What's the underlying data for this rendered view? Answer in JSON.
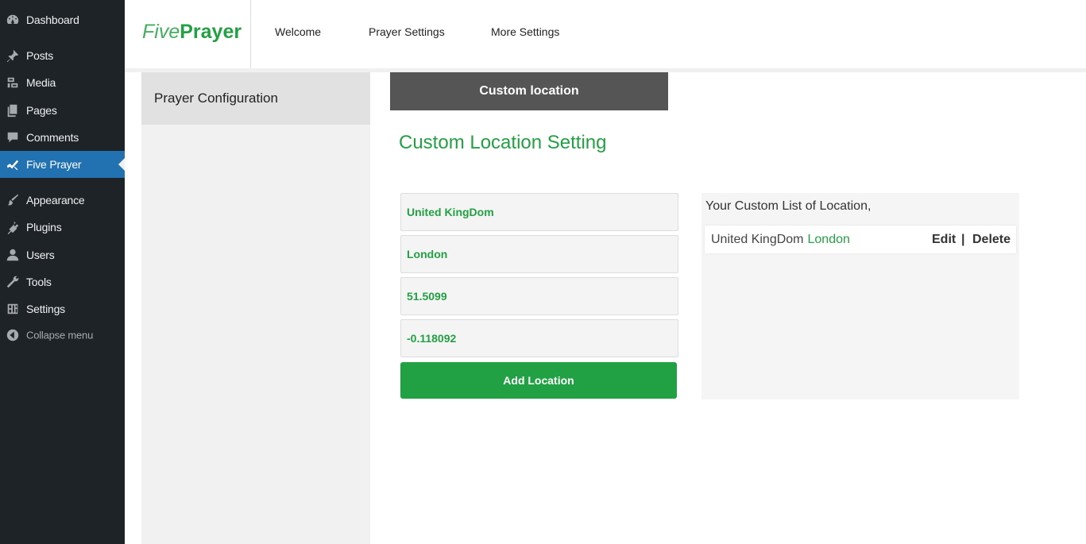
{
  "sidebar": {
    "items": [
      {
        "label": "Dashboard",
        "icon": "dashboard-icon"
      },
      {
        "label": "Posts",
        "icon": "pin-icon"
      },
      {
        "label": "Media",
        "icon": "media-icon"
      },
      {
        "label": "Pages",
        "icon": "pages-icon"
      },
      {
        "label": "Comments",
        "icon": "comment-icon"
      },
      {
        "label": "Five Prayer",
        "icon": "five-prayer-icon",
        "current": true
      },
      {
        "label": "Appearance",
        "icon": "brush-icon"
      },
      {
        "label": "Plugins",
        "icon": "plugin-icon"
      },
      {
        "label": "Users",
        "icon": "user-icon"
      },
      {
        "label": "Tools",
        "icon": "wrench-icon"
      },
      {
        "label": "Settings",
        "icon": "settings-icon"
      }
    ],
    "collapse_label": "Collapse menu",
    "colors": {
      "background": "#1d2327",
      "current": "#2271b1"
    }
  },
  "header": {
    "logo_light": "Five",
    "logo_bold": "Prayer",
    "nav": [
      "Welcome",
      "Prayer Settings",
      "More Settings"
    ]
  },
  "config": {
    "tab_label": "Prayer Configuration"
  },
  "custom": {
    "tab_label": "Custom location",
    "section_title": "Custom Location Setting",
    "fields": {
      "country": "United KingDom",
      "city": "London",
      "latitude": "51.5099",
      "longitude": "-0.118092"
    },
    "add_button": "Add Location",
    "accent_color": "#23a043"
  },
  "list": {
    "heading": "Your Custom List of Location,",
    "rows": [
      {
        "country": "United KingDom",
        "city": "London",
        "edit": "Edit",
        "separator": "|",
        "delete": "Delete"
      }
    ]
  }
}
